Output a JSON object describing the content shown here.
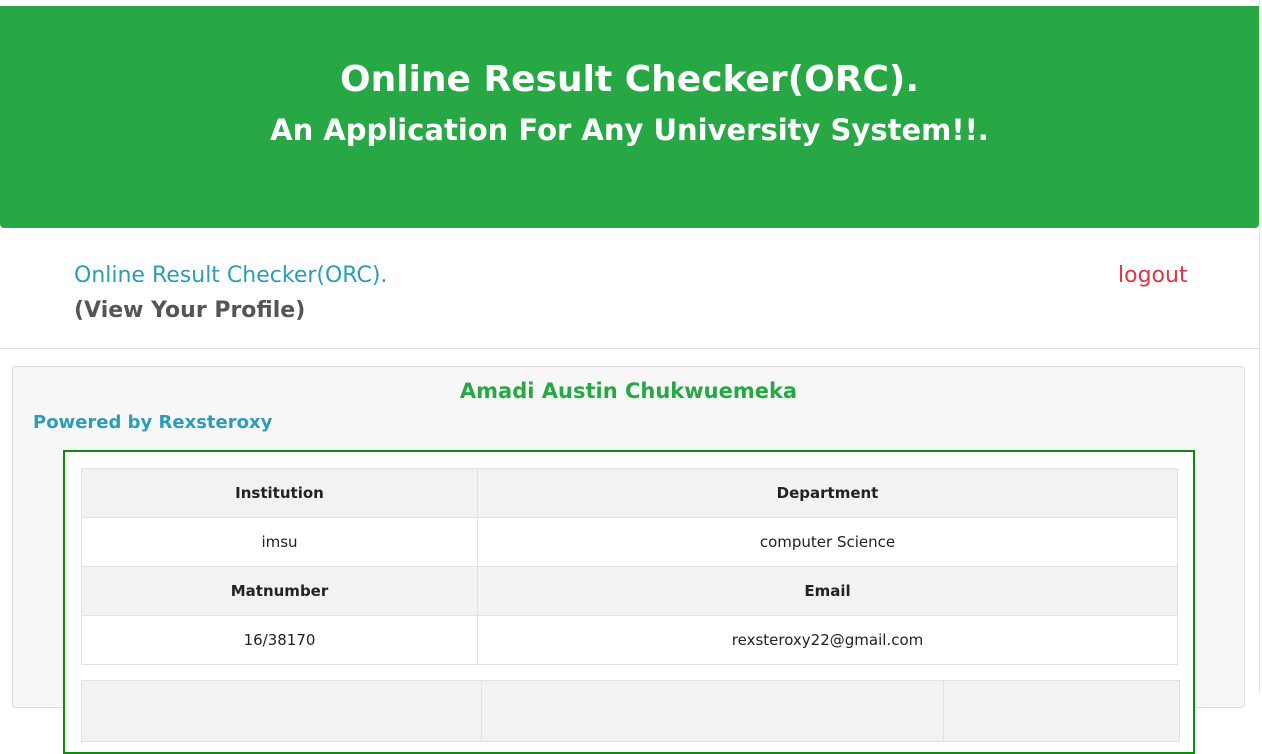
{
  "banner": {
    "title": "Online Result Checker(ORC).",
    "subtitle": "An Application For Any University System!!."
  },
  "nav": {
    "brand": "Online Result Checker(ORC).",
    "brand_sub": "(View Your Profile)",
    "logout": "logout"
  },
  "profile": {
    "student_name": "Amadi Austin Chukwuemeka",
    "powered_by": "Powered by Rexsteroxy",
    "headers_row1": [
      "Institution",
      "Department"
    ],
    "values_row1": [
      "imsu",
      "computer Science"
    ],
    "headers_row2": [
      "Matnumber",
      "Email"
    ],
    "values_row2": [
      "16/38170",
      "rexsteroxy22@gmail.com"
    ]
  },
  "colors": {
    "banner_green": "#28a745",
    "brand_teal": "#2d9cb5",
    "logout_red": "#dc3545",
    "box_border_green": "#0e8a0e"
  }
}
